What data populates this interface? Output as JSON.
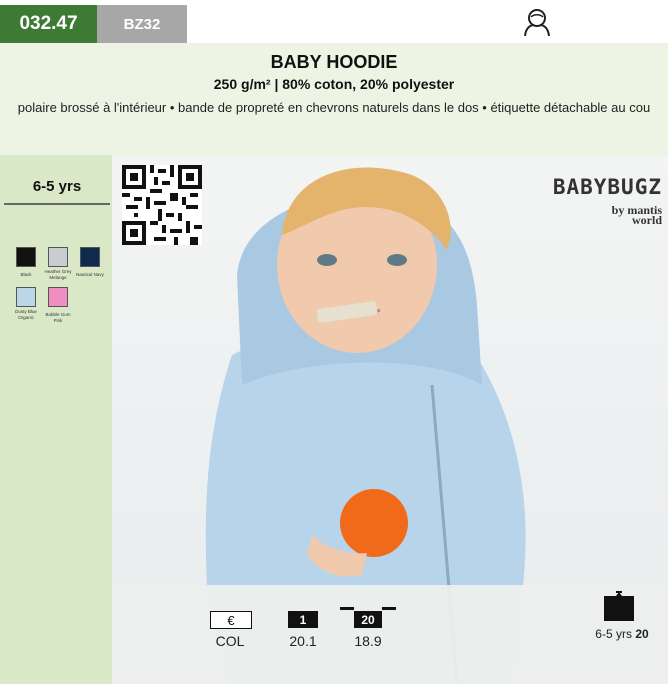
{
  "topbar": {
    "code": "032.47",
    "ref": "BZ32",
    "icon": "person-icon"
  },
  "header": {
    "title": "BABY HOODIE",
    "subtitle": "250 g/m² | 80% coton, 20% polyester",
    "description": "polaire brossé à l'intérieur • bande de propreté en chevrons naturels dans le dos • étiquette détachable au cou"
  },
  "sidebar": {
    "size": "6-5 yrs",
    "colors": [
      {
        "name": "Black",
        "hex": "#111111"
      },
      {
        "name": "Heather Grey Melange",
        "hex": "#c9ccd0"
      },
      {
        "name": "Nautical Navy",
        "hex": "#0f2a4d"
      },
      {
        "name": "Dusty Blue Organic",
        "hex": "#bcd6e8"
      },
      {
        "name": "Bubble Gum Pink",
        "hex": "#ef8fc1"
      }
    ]
  },
  "brand": {
    "name": "BABYBUGZ",
    "by": "by mantis",
    "world": "world"
  },
  "pricing": {
    "currency": "€",
    "col_label": "COL",
    "qty_1": "1",
    "price_1": "20.1",
    "qty_20": "20",
    "price_20": "18.9",
    "pack_size": "6-5 yrs",
    "pack_qty": "20",
    "pack_icon": "box-icon"
  },
  "colors": {
    "code_bg": "#3d7a34",
    "ref_bg": "#a7a7a7",
    "header_bg": "#eef4e3",
    "sidebar_bg": "#d9e9c8"
  }
}
